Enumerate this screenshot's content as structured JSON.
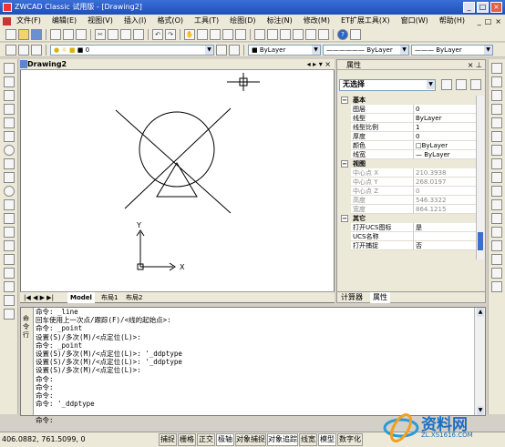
{
  "window": {
    "title": "ZWCAD Classic 试用版 - [Drawing2]",
    "min": "_",
    "max": "□",
    "close": "×"
  },
  "menu": {
    "items": [
      "文件(F)",
      "编辑(E)",
      "视图(V)",
      "插入(I)",
      "格式(O)",
      "工具(T)",
      "绘图(D)",
      "标注(N)",
      "修改(M)",
      "ET扩展工具(X)",
      "窗口(W)",
      "帮助(H)"
    ],
    "mdi_min": "_",
    "mdi_restore": "□",
    "mdi_close": "×"
  },
  "toolbar": {
    "layer_value": "0",
    "color_value": "ByLayer",
    "linetype_value": "ByLayer",
    "lineweight_value": "ByLayer"
  },
  "drawing": {
    "tab_title": "Drawing2",
    "tab_controls": "◂ ▸ ▾ ×",
    "ucs_x": "X",
    "ucs_y": "Y",
    "layout_tabs": [
      "Model",
      "布局1",
      "布局2"
    ],
    "layout_nav": "|◀ ◀ ▶ ▶|"
  },
  "properties": {
    "title": "属性",
    "selection": "无选择",
    "groups": [
      {
        "name": "基本",
        "rows": [
          {
            "key": "图层",
            "value": "0",
            "gray": false
          },
          {
            "key": "线型",
            "value": "ByLayer",
            "gray": false
          },
          {
            "key": "线型比例",
            "value": "1",
            "gray": false
          },
          {
            "key": "厚度",
            "value": "0",
            "gray": false
          },
          {
            "key": "颜色",
            "value": "□ByLayer",
            "gray": false
          },
          {
            "key": "线宽",
            "value": "— ByLayer",
            "gray": false
          }
        ]
      },
      {
        "name": "视图",
        "rows": [
          {
            "key": "中心点 X",
            "value": "210.3938",
            "gray": true
          },
          {
            "key": "中心点 Y",
            "value": "268.0197",
            "gray": true
          },
          {
            "key": "中心点 Z",
            "value": "0",
            "gray": true
          },
          {
            "key": "高度",
            "value": "546.3322",
            "gray": true
          },
          {
            "key": "宽度",
            "value": "864.1215",
            "gray": true
          }
        ]
      },
      {
        "name": "其它",
        "rows": [
          {
            "key": "打开UCS图标",
            "value": "是",
            "gray": false
          },
          {
            "key": "UCS名称",
            "value": "",
            "gray": false
          },
          {
            "key": "打开捕捉",
            "value": "否",
            "gray": false
          }
        ]
      }
    ],
    "tabs": [
      "计算器",
      "属性"
    ]
  },
  "command": {
    "side_label": "命令行",
    "lines": [
      "命令: _line",
      "回车使用上一次点/跟踪(F)/<线的起始点>:",
      "命令: _point",
      "设置(S)/多次(M)/<点定位(L)>:",
      "命令: _point",
      "设置(S)/多次(M)/<点定位(L)>: '_ddptype",
      "设置(S)/多次(M)/<点定位(L)>: '_ddptype",
      "设置(S)/多次(M)/<点定位(L)>:",
      "命令:",
      "命令:",
      "命令:",
      "命令: '_ddptype",
      "",
      "命令:"
    ]
  },
  "status": {
    "coords": "406.0882,  761.5099,  0",
    "buttons": [
      {
        "label": "捕捉",
        "on": false
      },
      {
        "label": "栅格",
        "on": false
      },
      {
        "label": "正交",
        "on": false
      },
      {
        "label": "极轴",
        "on": true
      },
      {
        "label": "对象捕捉",
        "on": false
      },
      {
        "label": "对象追踪",
        "on": true
      },
      {
        "label": "线宽",
        "on": false
      },
      {
        "label": "模型",
        "on": true
      },
      {
        "label": "数字化",
        "on": false
      }
    ]
  },
  "watermark": {
    "brand": "资料网",
    "url": "ZL.XS1616.COM"
  }
}
